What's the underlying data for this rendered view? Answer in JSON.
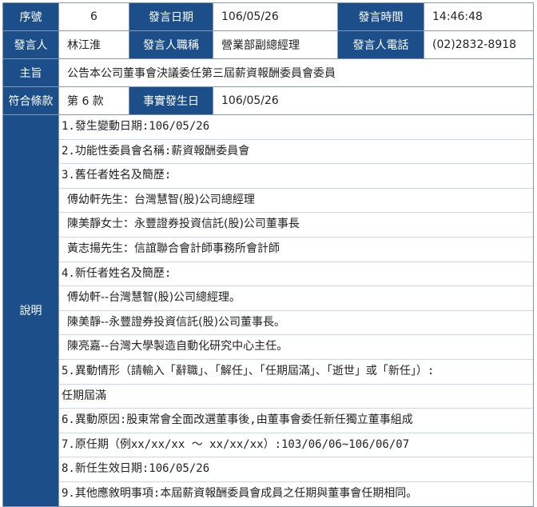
{
  "row1": {
    "seq_label": "序號",
    "seq_value": "6",
    "date_label": "發言日期",
    "date_value": "106/05/26",
    "time_label": "發言時間",
    "time_value": "14:46:48"
  },
  "row2": {
    "speaker_label": "發言人",
    "speaker_value": "林江淮",
    "title_label": "發言人職稱",
    "title_value": "營業部副總經理",
    "phone_label": "發言人電話",
    "phone_value": "(02)2832-8918"
  },
  "row3": {
    "subject_label": "主旨",
    "subject_value": "公告本公司董事會決議委任第三屆薪資報酬委員會委員"
  },
  "row4": {
    "clause_label": "符合條款",
    "clause_value": "第 6 款",
    "event_date_label": "事實發生日",
    "event_date_value": "106/05/26"
  },
  "description": {
    "label": "說明",
    "lines": [
      {
        "text": "1.發生變動日期:106/05/26",
        "style": "mono"
      },
      {
        "text": "2.功能性委員會名稱:薪資報酬委員會",
        "style": "mono"
      },
      {
        "text": "3.舊任者姓名及簡歷:",
        "style": "mono"
      },
      {
        "text": "傅幼軒先生：台灣慧智(股)公司總經理",
        "style": "indent"
      },
      {
        "text": "陳美靜女士：永豐證券投資信託(股)公司董事長",
        "style": "indent"
      },
      {
        "text": "黃志揚先生：信誼聯合會計師事務所會計師",
        "style": "indent"
      },
      {
        "text": "4.新任者姓名及簡歷:",
        "style": "mono"
      },
      {
        "text": "傅幼軒--台灣慧智(股)公司總經理。",
        "style": "indent"
      },
      {
        "text": "陳美靜--永豐證券投資信託(股)公司董事長。",
        "style": "indent"
      },
      {
        "text": "陳亮嘉--台灣大學製造自動化研究中心主任。",
        "style": "indent"
      },
      {
        "text": "5.異動情形（請輸入「辭職」、「解任」、「任期屆滿」、「逝世」或「新任」）:",
        "style": "mono"
      },
      {
        "text": "任期屆滿",
        "style": "plain"
      },
      {
        "text": "6.異動原因:股東常會全面改選董事後,由董事會委任新任獨立董事組成",
        "style": "mono"
      },
      {
        "text": "7.原任期（例xx/xx/xx ～ xx/xx/xx）:103/06/06~106/06/07",
        "style": "mono"
      },
      {
        "text": "8.新任生效日期:106/05/26",
        "style": "mono"
      },
      {
        "text": "9.其他應敘明事項:本屆薪資報酬委員會成員之任期與董事會任期相同。",
        "style": "mono"
      }
    ]
  },
  "colors": {
    "header_bg": "#1c4f8a",
    "border": "#7f99b5"
  }
}
